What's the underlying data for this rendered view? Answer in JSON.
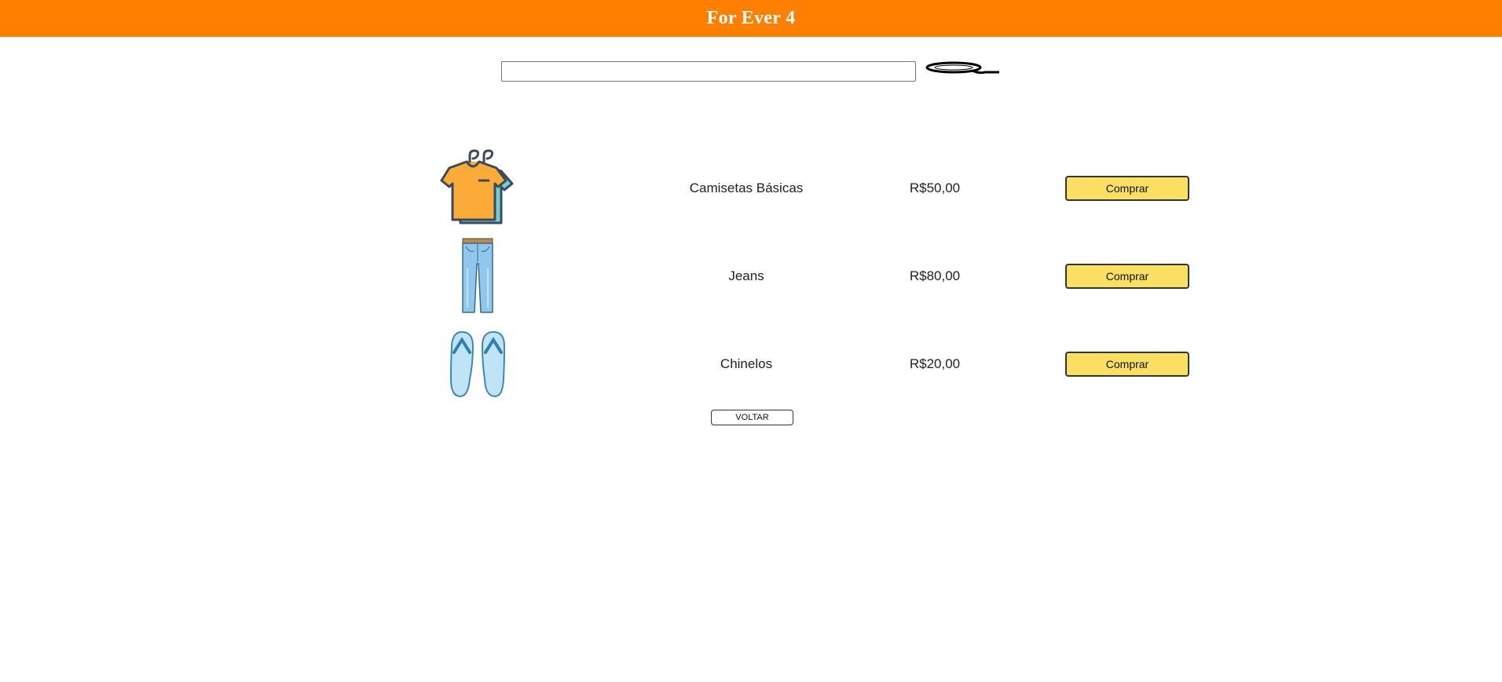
{
  "header": {
    "title": "For Ever 4",
    "background_color": "#ff7f00"
  },
  "search": {
    "value": "",
    "placeholder": "",
    "icon": "search-icon"
  },
  "products": [
    {
      "image_icon": "t-shirt-icon",
      "name": "Camisetas Básicas",
      "price": "R$50,00",
      "buy_label": "Comprar"
    },
    {
      "image_icon": "jeans-icon",
      "name": "Jeans",
      "price": "R$80,00",
      "buy_label": "Comprar"
    },
    {
      "image_icon": "flip-flops-icon",
      "name": "Chinelos",
      "price": "R$20,00",
      "buy_label": "Comprar"
    }
  ],
  "colors": {
    "buy_button": "#fbdf63"
  },
  "back_label": "VOLTAR"
}
